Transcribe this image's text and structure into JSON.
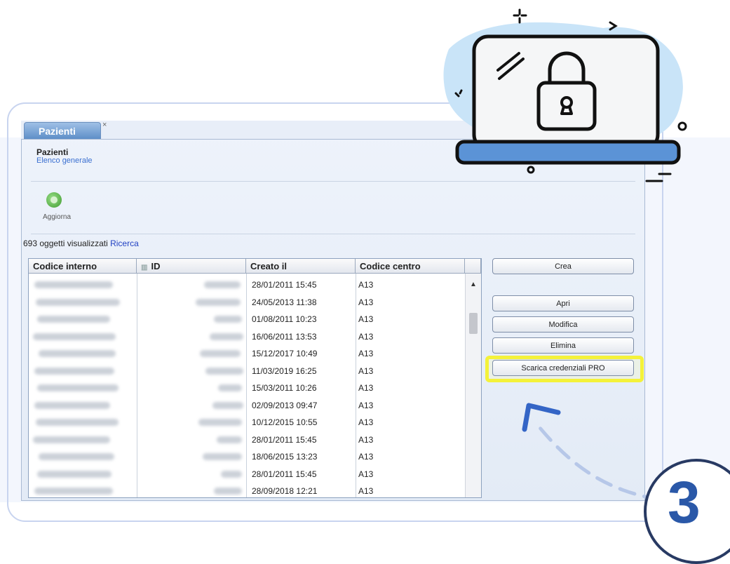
{
  "tab": {
    "label": "Pazienti",
    "close": "×"
  },
  "breadcrumb": {
    "title": "Pazienti",
    "subtitle": "Elenco generale"
  },
  "toolbar": {
    "refresh_label": "Aggiorna"
  },
  "status": {
    "count_text": "693 oggetti visualizzati",
    "search_link": "Ricerca"
  },
  "grid": {
    "headers": [
      "Codice interno",
      "ID",
      "Creato il",
      "Codice centro"
    ],
    "rows": [
      {
        "created": "28/01/2011 15:45",
        "centro": "A13"
      },
      {
        "created": "24/05/2013 11:38",
        "centro": "A13"
      },
      {
        "created": "01/08/2011 10:23",
        "centro": "A13"
      },
      {
        "created": "16/06/2011 13:53",
        "centro": "A13"
      },
      {
        "created": "15/12/2017 10:49",
        "centro": "A13"
      },
      {
        "created": "11/03/2019 16:25",
        "centro": "A13"
      },
      {
        "created": "15/03/2011 10:26",
        "centro": "A13"
      },
      {
        "created": "02/09/2013 09:47",
        "centro": "A13"
      },
      {
        "created": "10/12/2015 10:55",
        "centro": "A13"
      },
      {
        "created": "28/01/2011 15:45",
        "centro": "A13"
      },
      {
        "created": "18/06/2015 13:23",
        "centro": "A13"
      },
      {
        "created": "28/01/2011 15:45",
        "centro": "A13"
      },
      {
        "created": "28/09/2018 12:21",
        "centro": "A13"
      }
    ]
  },
  "actions": {
    "crea": "Crea",
    "apri": "Apri",
    "modifica": "Modifica",
    "elimina": "Elimina",
    "scarica": "Scarica credenziali PRO"
  },
  "step": {
    "number": "3"
  },
  "colors": {
    "highlight": "#f4f23a",
    "step_number": "#2a58a8",
    "laptop_screen": "#c9e4f8",
    "laptop_base": "#5b93d6"
  },
  "icons": [
    "refresh-icon",
    "lock-icon",
    "laptop-icon",
    "filter-icon",
    "scroll-up-icon"
  ]
}
